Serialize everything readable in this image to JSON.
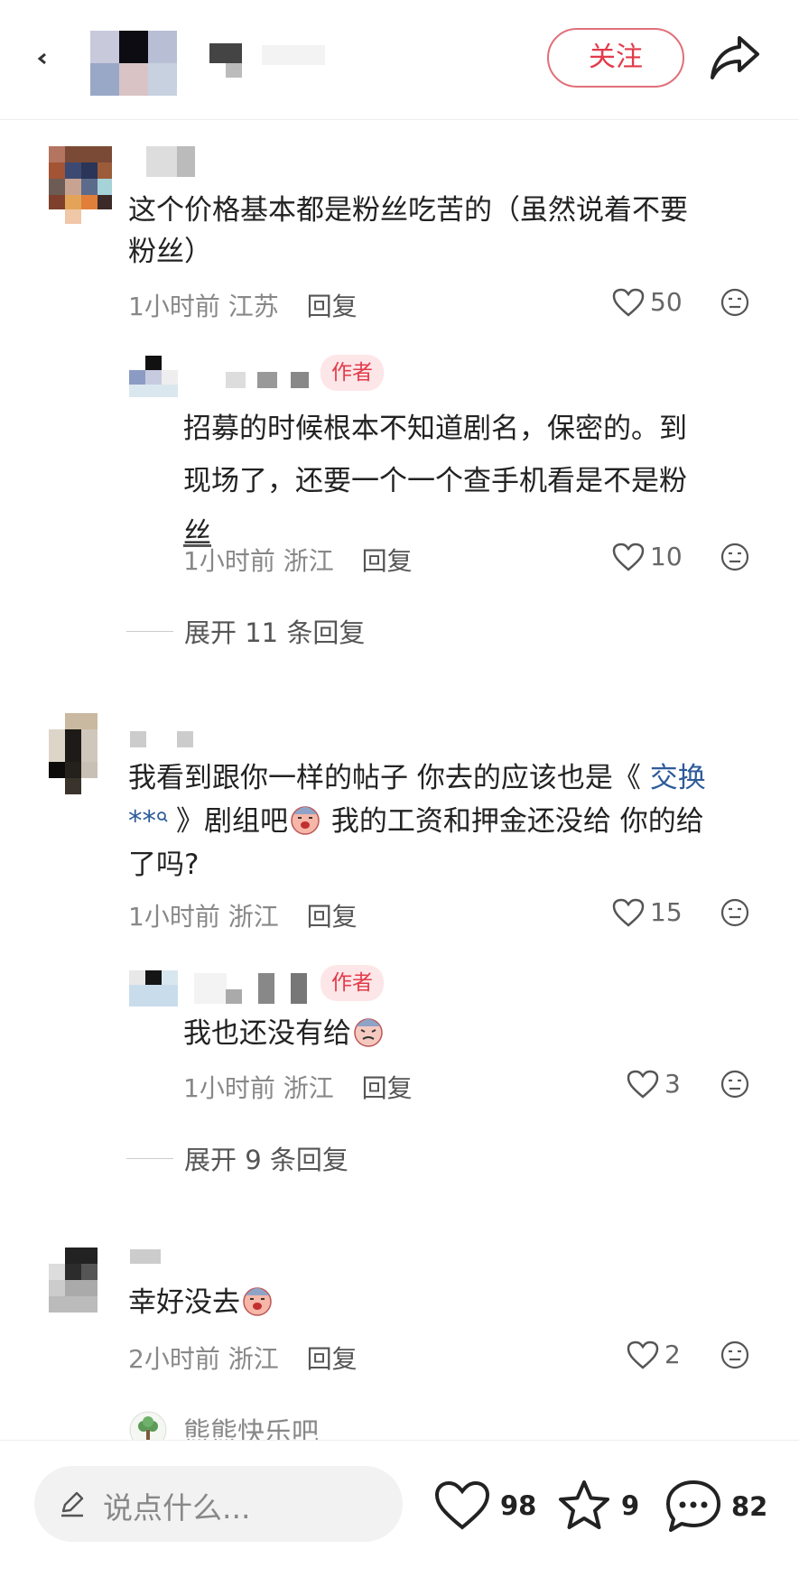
{
  "header": {
    "follow_label": "关注"
  },
  "comments": [
    {
      "text": "这个价格基本都是粉丝吃苦的（虽然说着不要粉丝）",
      "line1": "这个价格基本都是粉丝吃苦的（虽然说着不要",
      "line2": "粉丝）",
      "time": "1小时前",
      "location": "江苏",
      "reply_label": "回复",
      "likes": "50"
    },
    {
      "badge": "作者",
      "line1": "招募的时候根本不知道剧名，保密的。到",
      "line2": "现场了，还要一个一个查手机看是不是粉",
      "line3": "丝",
      "time": "1小时前",
      "location": "浙江",
      "reply_label": "回复",
      "likes": "10"
    },
    {
      "expand": "展开 11 条回复"
    },
    {
      "line1_a": "我看到跟你一样的帖子 你去的应该也是《",
      "line1_link": "交换",
      "line2_link": "**",
      "line2_b": "》剧组吧",
      "line2_c": "我的工资和押金还没给 你的给",
      "line3": "了吗?",
      "time": "1小时前",
      "location": "浙江",
      "reply_label": "回复",
      "likes": "15"
    },
    {
      "badge": "作者",
      "line1": "我也还没有给",
      "time": "1小时前",
      "location": "浙江",
      "reply_label": "回复",
      "likes": "3"
    },
    {
      "expand": "展开 9 条回复"
    },
    {
      "line1": "幸好没去",
      "time": "2小时前",
      "location": "浙江",
      "reply_label": "回复",
      "likes": "2"
    },
    {
      "partial_name": "熊熊快乐吧"
    }
  ],
  "bottom": {
    "placeholder": "说点什么...",
    "likes": "98",
    "stars": "9",
    "comments": "82"
  },
  "colors": {
    "accent": "#e23b4a",
    "link": "#2d5b9a"
  }
}
